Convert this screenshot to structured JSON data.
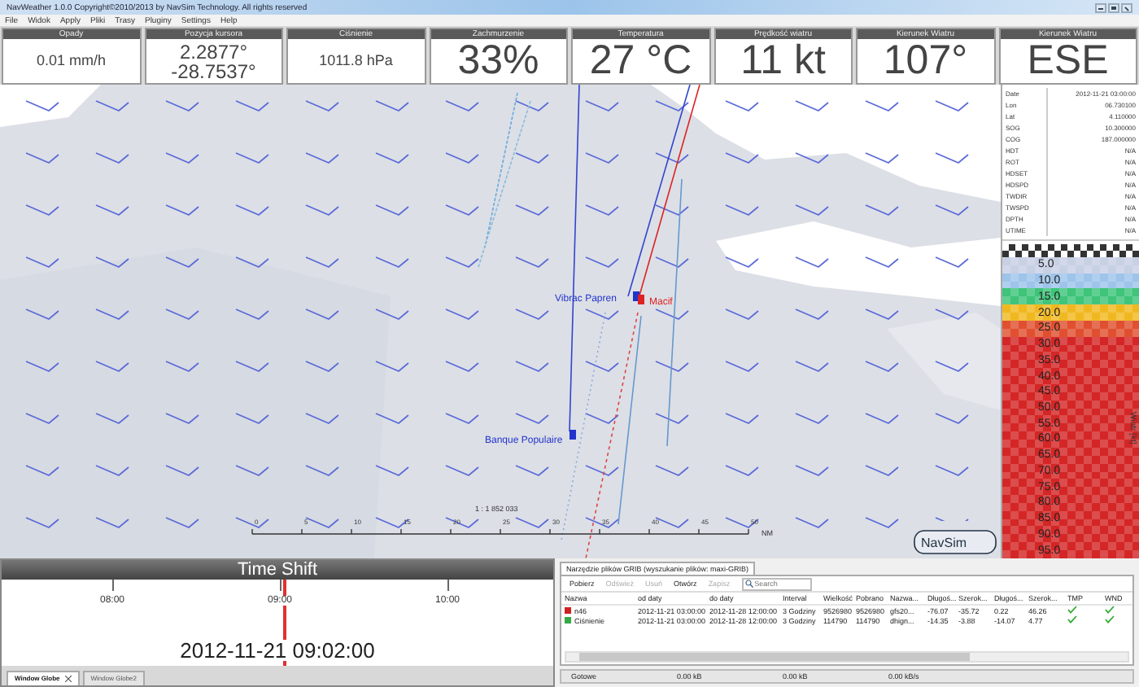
{
  "window": {
    "title": "NavWeather 1.0.0 Copyright©2010/2013 by NavSim Technology. All rights reserved"
  },
  "menu": [
    "File",
    "Widok",
    "Apply",
    "Pliki",
    "Trasy",
    "Pluginy",
    "Settings",
    "Help"
  ],
  "gauges": [
    {
      "title": "Opady",
      "lines": [
        "0.01 mm/h"
      ],
      "kind": "small"
    },
    {
      "title": "Pozycja kursora",
      "lines": [
        "2.2877°",
        "-28.7537°"
      ],
      "kind": "double"
    },
    {
      "title": "Ciśnienie",
      "lines": [
        "1011.8 hPa"
      ],
      "kind": "small"
    },
    {
      "title": "Zachmurzenie",
      "lines": [
        "33%"
      ],
      "kind": "large"
    },
    {
      "title": "Temperatura",
      "lines": [
        "27 °C"
      ],
      "kind": "large"
    },
    {
      "title": "Prędkość wiatru",
      "lines": [
        "11 kt"
      ],
      "kind": "large"
    },
    {
      "title": "Kierunek Wiatru",
      "lines": [
        "107°"
      ],
      "kind": "large"
    },
    {
      "title": "Kierunek Wiatru",
      "lines": [
        "ESE"
      ],
      "kind": "large"
    }
  ],
  "map": {
    "boats": [
      {
        "name": "Vibrac Papren",
        "color": "#2233cc"
      },
      {
        "name": "Macif",
        "color": "#dd2222"
      },
      {
        "name": "Banque Populaire",
        "color": "#2233cc"
      }
    ],
    "scale": {
      "ratio": "1 : 1 852 033",
      "ticks": [
        "0",
        "5",
        "10",
        "15",
        "20",
        "25",
        "30",
        "35",
        "40",
        "45",
        "50"
      ],
      "unit": "NM"
    },
    "logo": "NavSim"
  },
  "info": [
    {
      "key": "Date",
      "value": "2012-11-21 03:00:00"
    },
    {
      "key": "Lon",
      "value": "06.730100"
    },
    {
      "key": "Lat",
      "value": "4.110000"
    },
    {
      "key": "SOG",
      "value": "10.300000"
    },
    {
      "key": "COG",
      "value": "187.000000"
    },
    {
      "key": "HDT",
      "value": "N/A"
    },
    {
      "key": "ROT",
      "value": "N/A"
    },
    {
      "key": "HDSET",
      "value": "N/A"
    },
    {
      "key": "HDSPD",
      "value": "N/A"
    },
    {
      "key": "TWDIR",
      "value": "N/A"
    },
    {
      "key": "TWSPD",
      "value": "N/A"
    },
    {
      "key": "DPTH",
      "value": "N/A"
    },
    {
      "key": "UTIME",
      "value": "N/A"
    }
  ],
  "wind_legend": {
    "unit_label": "Wiatr [kt]",
    "steps": [
      {
        "label": "5.0",
        "color": "#c8d0e4"
      },
      {
        "label": "10.0",
        "color": "#9ec4ea"
      },
      {
        "label": "15.0",
        "color": "#3fc47a"
      },
      {
        "label": "20.0",
        "color": "#f0b820"
      },
      {
        "label": "25.0",
        "color": "#e05030"
      },
      {
        "label": "30.0",
        "color": "#d42626"
      },
      {
        "label": "35.0",
        "color": "#d42626"
      },
      {
        "label": "40.0",
        "color": "#d42626"
      },
      {
        "label": "45.0",
        "color": "#d42626"
      },
      {
        "label": "50.0",
        "color": "#d42626"
      },
      {
        "label": "55.0",
        "color": "#d42626"
      },
      {
        "label": "60.0",
        "color": "#d42626"
      },
      {
        "label": "65.0",
        "color": "#d42626"
      },
      {
        "label": "70.0",
        "color": "#d42626"
      },
      {
        "label": "75.0",
        "color": "#d42626"
      },
      {
        "label": "80.0",
        "color": "#d42626"
      },
      {
        "label": "85.0",
        "color": "#d42626"
      },
      {
        "label": "90.0",
        "color": "#d42626"
      },
      {
        "label": "95.0",
        "color": "#d42626"
      }
    ]
  },
  "time_shift": {
    "title": "Time Shift",
    "ticks": [
      "08:00",
      "09:00",
      "10:00"
    ],
    "level": 0.505,
    "current": "2012-11-21 09:02:00"
  },
  "view_tabs": [
    {
      "label": "Window Globe",
      "selected": true
    },
    {
      "label": "Window Globe2",
      "selected": false
    }
  ],
  "grib": {
    "tab": "Narzędzie plików GRIB (wyszukanie plików: maxi-GRIB)",
    "toolbar": [
      {
        "label": "Pobierz",
        "disabled": false
      },
      {
        "label": "Odśwież",
        "disabled": true
      },
      {
        "label": "Usuń",
        "disabled": true
      },
      {
        "label": "Otwórz",
        "disabled": false
      },
      {
        "label": "Zapisz",
        "disabled": true
      }
    ],
    "search": {
      "placeholder": "Search"
    },
    "columns": [
      "Nazwa",
      "od daty",
      "do daty",
      "Interval",
      "Wielkość",
      "Pobrano",
      "Nazwa...",
      "Długoś...",
      "Szerok...",
      "Długoś...",
      "Szerok...",
      "TMP",
      "WND"
    ],
    "rows": [
      {
        "color": "#cc2222",
        "tmp": true,
        "wnd": true,
        "cells": [
          "n46",
          "2012-11-21 03:00:00",
          "2012-11-28 12:00:00",
          "3 Godziny",
          "9526980",
          "9526980",
          "gfs20...",
          "-76.07",
          "-35.72",
          "0.22",
          "46.26"
        ]
      },
      {
        "color": "#33aa44",
        "tmp": true,
        "wnd": true,
        "cells": [
          "Ciśnienie",
          "2012-11-21 03:00:00",
          "2012-11-28 12:00:00",
          "3 Godziny",
          "114790",
          "114790",
          "dhign...",
          "-14.35",
          "-3.88",
          "-14.07",
          "4.77"
        ]
      }
    ],
    "status": [
      "Gotowe",
      "0.00 kB",
      "0.00 kB",
      "0.00 kB/s"
    ]
  }
}
